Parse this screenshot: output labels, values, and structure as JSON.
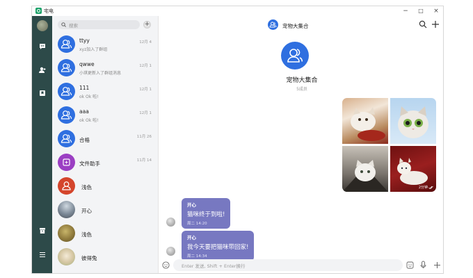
{
  "app": {
    "title": "宅电"
  },
  "window_controls": {
    "minimize": "−",
    "maximize": "□",
    "close": "×"
  },
  "search": {
    "placeholder": "搜索"
  },
  "conversations": [
    {
      "name": "ttyy",
      "preview": "xyz加入了群组",
      "time": "12月 4",
      "avatar": "group-icon"
    },
    {
      "name": "qwwe",
      "preview": "小琪更新入了群组消息",
      "time": "12月 1",
      "avatar": "group-icon"
    },
    {
      "name": "111",
      "preview": "ok Ok 啦!",
      "time": "12月 1",
      "avatar": "group-icon"
    },
    {
      "name": "aaa",
      "preview": "ok Ok 啦!",
      "time": "12月 1",
      "avatar": "group-icon"
    },
    {
      "name": "合格",
      "preview": "",
      "time": "11月 26",
      "avatar": "group-icon"
    },
    {
      "name": "文件助手",
      "preview": "",
      "time": "11月 14",
      "avatar": "file-helper-icon"
    },
    {
      "name": "浅色",
      "preview": "",
      "time": "",
      "avatar": "user-icon"
    },
    {
      "name": "开心",
      "preview": "",
      "time": "",
      "avatar": "photo-avatar"
    },
    {
      "name": "浅色",
      "preview": "",
      "time": "",
      "avatar": "photo-avatar"
    },
    {
      "name": "彼得兔",
      "preview": "",
      "time": "",
      "avatar": "photo-avatar"
    }
  ],
  "chat": {
    "title": "宠物大集合",
    "group_name": "宠物大集合",
    "member_count": "5成员",
    "image_time": "2分钟",
    "messages": [
      {
        "sender": "开心",
        "text": "猫咪终于到啦!",
        "time": "周二 14:20"
      },
      {
        "sender": "开心",
        "text": "我今天要把猫咪带回家!",
        "time": "周二 14:34"
      }
    ]
  },
  "composer": {
    "placeholder": "Enter 发送, Shift + Enter换行"
  },
  "colors": {
    "sidebar": "#2d4a49",
    "accent": "#2f6fe0",
    "bubble": "#7778c1"
  }
}
